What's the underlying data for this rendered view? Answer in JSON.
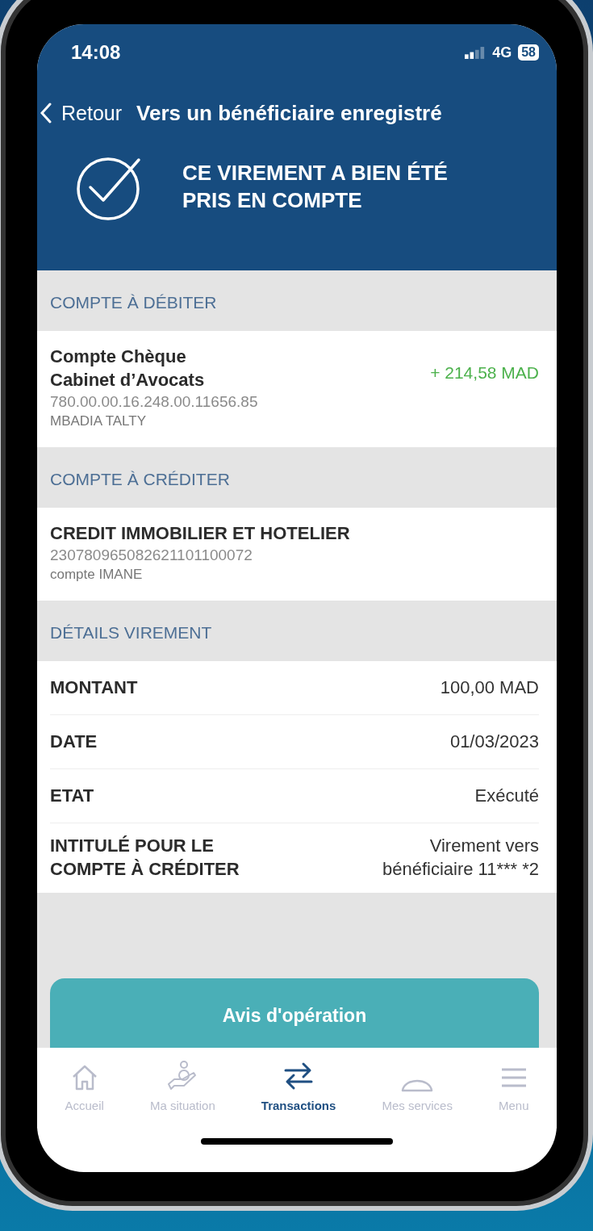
{
  "status_bar": {
    "time": "14:08",
    "network": "4G",
    "battery": "58"
  },
  "nav": {
    "back": "Retour",
    "title": "Vers un bénéficiaire enregistré"
  },
  "confirmation": {
    "message": "CE VIREMENT A BIEN ÉTÉ PRIS EN COMPTE"
  },
  "debit_account": {
    "header": "COMPTE À DÉBITER",
    "name": "Compte Chèque Cabinet d’Avocats",
    "number": "780.00.00.16.248.00.11656.85",
    "holder": "MBADIA TALTY",
    "balance": "+ 214,58 MAD"
  },
  "credit_account": {
    "header": "COMPTE À CRÉDITER",
    "name": "CREDIT IMMOBILIER ET HOTELIER",
    "number": "230780965082621101100072",
    "holder": "compte IMANE"
  },
  "details": {
    "header": "DÉTAILS VIREMENT",
    "rows": [
      {
        "label": "MONTANT",
        "value": "100,00 MAD"
      },
      {
        "label": "DATE",
        "value": "01/03/2023"
      },
      {
        "label": "ETAT",
        "value": "Exécuté"
      },
      {
        "label": "INTITULÉ POUR LE COMPTE À CRÉDITER",
        "value": "Virement vers bénéficiaire 11*** *2"
      }
    ]
  },
  "action_button": "Avis d'opération",
  "tab_bar": [
    {
      "label": "Accueil",
      "selected": false
    },
    {
      "label": "Ma situation",
      "selected": false
    },
    {
      "label": "Transactions",
      "selected": true
    },
    {
      "label": "Mes services",
      "selected": false
    },
    {
      "label": "Menu",
      "selected": false
    }
  ]
}
